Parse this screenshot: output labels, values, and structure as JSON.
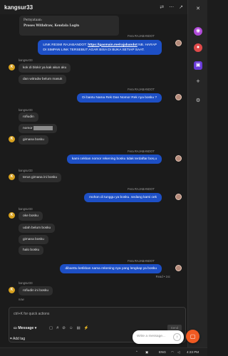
{
  "window": {
    "title": "kangsur33",
    "icons": [
      "translate-icon",
      "more-icon",
      "external-link-icon"
    ]
  },
  "colors": {
    "accent_blue": "#1d4fc5",
    "avatar_yellow": "#d8a21f",
    "widget_orange": "#f05a22"
  },
  "system_card": {
    "line1": "Pernyataan:",
    "line2": "Proses Withdraw, Kendala Login"
  },
  "messages": {
    "m1_sender": "Fera RAJABANDOT",
    "m1_line1_a": "LINK RESMI RAJABANDOT: ",
    "m1_line1_link": "https://gasmain.me/rajabandot",
    "m1_line1_b": " NB. HARAP",
    "m1_line2": "DI SIMPAN LINK TERSEBUT AGAR BISA DI BUKA SETIAP SAAT.",
    "g1_sender": "kangsur33",
    "g1_avatar": "K",
    "g1_a": "kok di blokir ya kak akun aku",
    "g1_b": "dan witradw belum masuk",
    "m2_sender": "Fera RAJABANDOT",
    "m2_text": "Di bantu Nama Rek Dan Nomor Rek nya bosku ?",
    "g2_sender": "kangsur33",
    "g2_avatar": "K",
    "g2_a": "rofiudin",
    "g2_b": "nomor",
    "g2_c": "gimana bosku",
    "m3_sender": "Fera RAJABANDOT",
    "m3_text": "kami cekkan nomor rekening bosku tidak terdaftar bos,u",
    "g3_sender": "kangsur33",
    "g3_avatar": "K",
    "g3_a": "terus gimana ini bosku",
    "m4_sender": "Fera RAJABANDOT",
    "m4_text": "mohon di tunggu ya bosku. sedang kami cek",
    "g4_sender": "kangsur33",
    "g4_avatar": "K",
    "g4_a": "oke bosku",
    "g4_b": "udah belum bosku",
    "g4_c": "gimana bosku",
    "g4_d": "halo bosku",
    "m5_sender": "Fera RAJABANDOT",
    "m5_text": "dibanttu ketikkan nama rekening nya yang lengkap ya bosku",
    "m5_status": "Read • 1sc",
    "g5_sender": "kangsur33",
    "g5_avatar": "K",
    "g5_a": "rofiudin ini bosku",
    "g5_time": "now"
  },
  "composer": {
    "placeholder": "ctrl+K for quick actions",
    "mode": "Message",
    "send_label": "Send",
    "add_tag": "Add tag"
  },
  "widget": {
    "placeholder": "Write a message..."
  },
  "taskbar": {
    "lang": "ENG",
    "time": "4:23 PM"
  }
}
